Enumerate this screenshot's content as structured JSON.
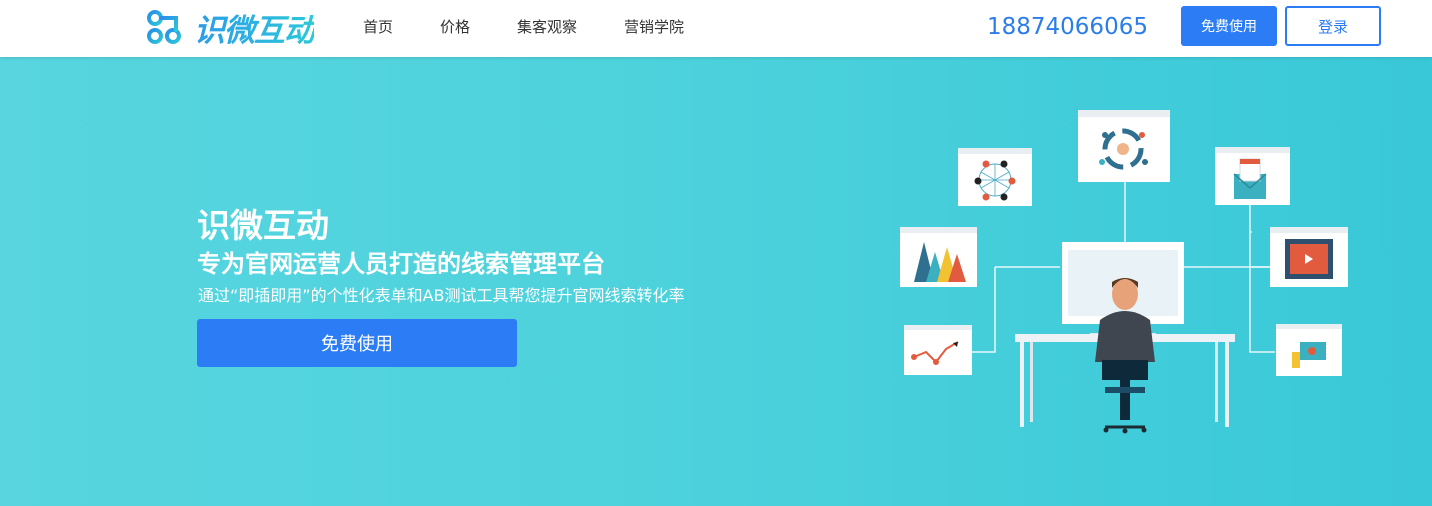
{
  "header": {
    "logo_text": "识微互动",
    "nav": [
      "首页",
      "价格",
      "集客观察",
      "营销学院"
    ],
    "phone": "18874066065",
    "free_button": "免费使用",
    "login_button": "登录"
  },
  "hero": {
    "title": "识微互动",
    "subtitle": "专为官网运营人员打造的线索管理平台",
    "description": "通过“即插即用”的个性化表单和AB测试工具帮您提升官网线索转化率",
    "cta": "免费使用"
  },
  "colors": {
    "accent": "#2b7cf5",
    "hero_bg": "#4dd2dc",
    "phone": "#2b7de9"
  },
  "icons": [
    "logo-mark-icon",
    "workspace-illustration"
  ]
}
